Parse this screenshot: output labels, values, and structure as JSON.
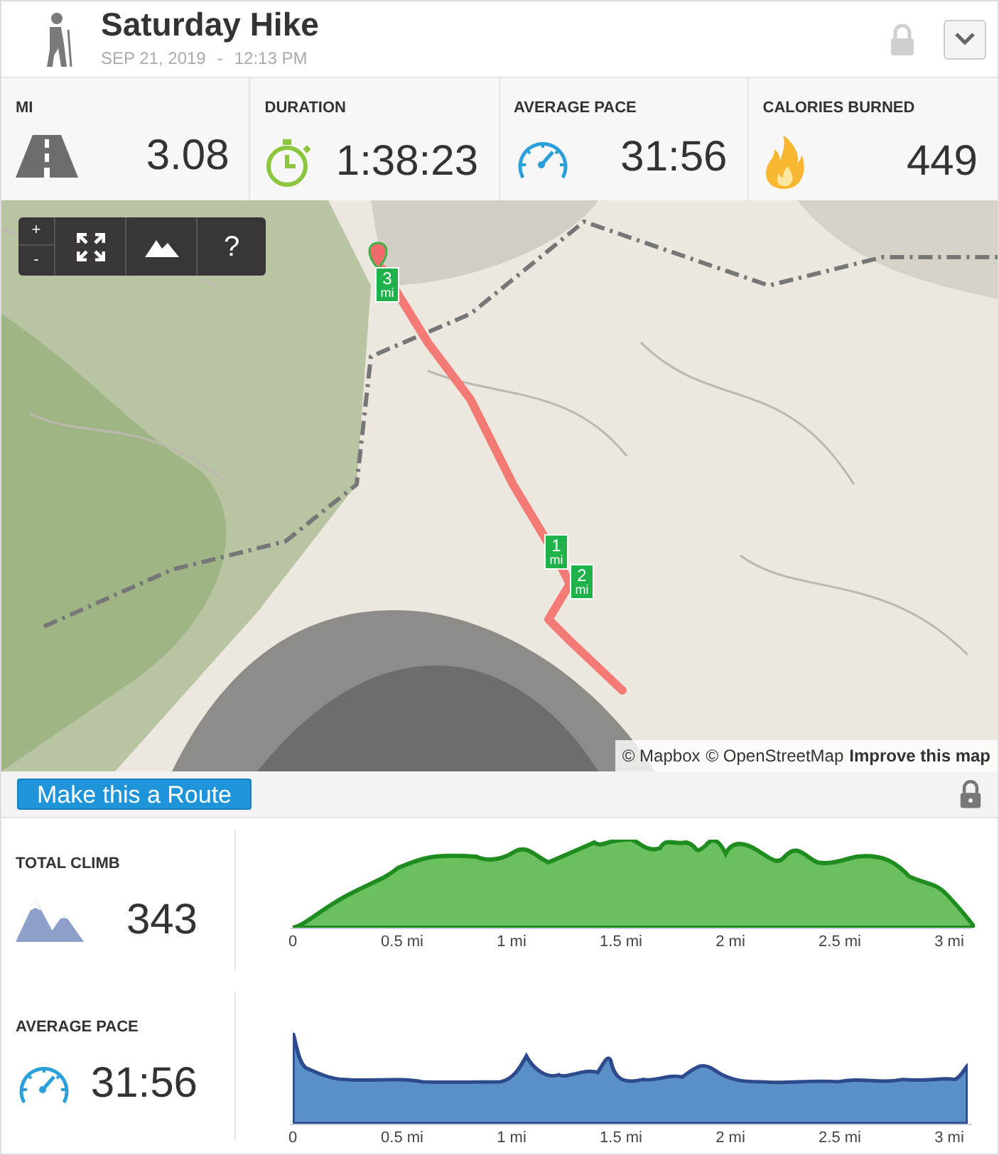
{
  "header": {
    "title": "Saturday Hike",
    "date": "SEP 21, 2019",
    "separator": "-",
    "time": "12:13 PM"
  },
  "stats": [
    {
      "kind": "distance",
      "label": "MI",
      "value": "3.08"
    },
    {
      "kind": "duration",
      "label": "DURATION",
      "value": "1:38:23"
    },
    {
      "kind": "pace",
      "label": "AVERAGE PACE",
      "value": "31:56"
    },
    {
      "kind": "calories",
      "label": "CALORIES BURNED",
      "value": "449"
    }
  ],
  "map": {
    "zoom_in": "+",
    "zoom_out": "-",
    "help": "?",
    "markers": [
      {
        "number": "3",
        "unit": "mi"
      },
      {
        "number": "1",
        "unit": "mi"
      },
      {
        "number": "2",
        "unit": "mi"
      }
    ],
    "attribution": {
      "mapbox": "© Mapbox",
      "osm": "© OpenStreetMap",
      "improve": "Improve this map"
    }
  },
  "route_button": "Make this a Route",
  "charts": [
    {
      "kind": "climb",
      "label": "TOTAL CLIMB",
      "value": "343",
      "xticks": [
        "0",
        "0.5 mi",
        "1 mi",
        "1.5 mi",
        "2 mi",
        "2.5 mi",
        "3 mi"
      ]
    },
    {
      "kind": "pace",
      "label": "AVERAGE PACE",
      "value": "31:56",
      "xticks": [
        "0",
        "0.5 mi",
        "1 mi",
        "1.5 mi",
        "2 mi",
        "2.5 mi",
        "3 mi"
      ]
    }
  ]
}
